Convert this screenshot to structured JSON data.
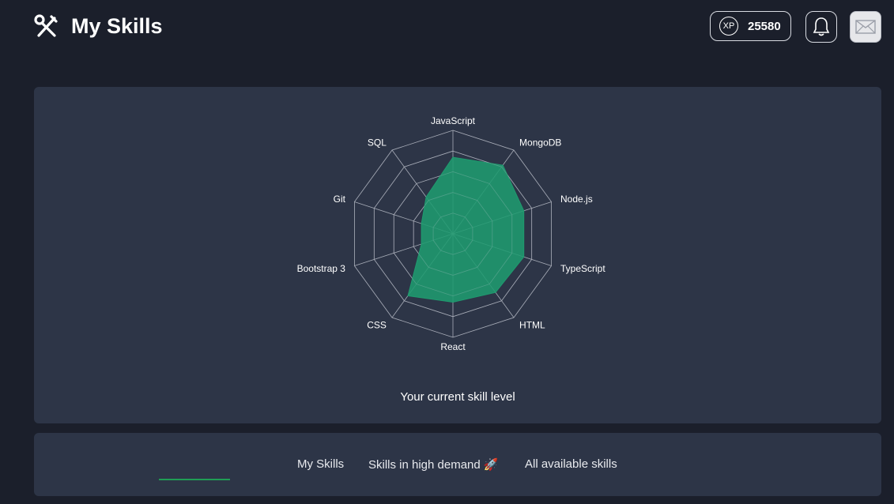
{
  "header": {
    "title": "My Skills",
    "xp_label": "XP",
    "xp_value": "25580"
  },
  "icons": {
    "logo": "tools-icon",
    "bell": "bell-icon",
    "mail": "mail-icon",
    "rocket": "rocket-icon"
  },
  "chart_data": {
    "type": "radar",
    "axes": [
      "JavaScript",
      "MongoDB",
      "Node.js",
      "TypeScript",
      "HTML",
      "React",
      "CSS",
      "Bootstrap 3",
      "Git",
      "SQL"
    ],
    "values": [
      3.7,
      4.1,
      3.6,
      3.6,
      3.5,
      3.3,
      3.7,
      1.6,
      1.6,
      2.2
    ],
    "rmax": 5,
    "rings": 5,
    "fill_color": "#1f9b6f",
    "grid_color": "#a8adb8",
    "caption": "Your current skill level"
  },
  "tabs": [
    {
      "label": "My Skills"
    },
    {
      "label": "Skills in high demand",
      "emoji": "🚀"
    },
    {
      "label": "All available skills"
    }
  ],
  "colors": {
    "background": "#1b1f2b",
    "card": "#2d3547",
    "accent": "#1f9d55"
  }
}
